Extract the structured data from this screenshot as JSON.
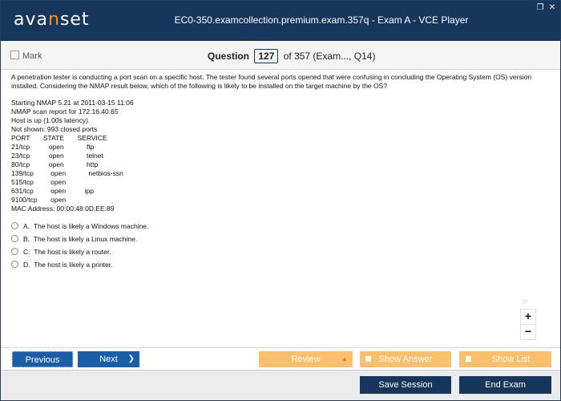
{
  "app": {
    "logo_prefix": "ava",
    "logo_accent": "n",
    "logo_suffix": "set",
    "window_title": "EC0-350.examcollection.premium.exam.357q - Exam A - VCE Player",
    "restore_glyph": "❐",
    "close_glyph": "✕"
  },
  "subbar": {
    "mark_label": "Mark",
    "question_label": "Question",
    "question_number": "127",
    "question_of": "of 357 (Exam..., Q14)"
  },
  "question": {
    "text": "A penetration tester is conducting a port scan on a specific host. The tester found several ports opened that were confusing in concluding the Operating System (OS) version installed. Considering the NMAP result below, which of the following is likely to be installed on the target machine by the OS?",
    "nmap": [
      "Starting NMAP 5.21 at 2011-03-15 11:06",
      "NMAP scan report for 172.16.40.65",
      "Host is up (1.00s latency).",
      "Not shown: 993 closed ports",
      "PORT       STATE       SERVICE",
      "21/tcp          open            ftp",
      "23/tcp          open            telnet",
      "80/tcp          open            http",
      "139/tcp         open            netbios-ssn",
      "515/tcp         open",
      "631/tcp         open          ipp",
      "9100/tcp       open",
      "MAC Address: 00:00:48:0D:EE:89"
    ],
    "options": [
      {
        "letter": "A.",
        "text": "The host is likely a Windows machine."
      },
      {
        "letter": "B.",
        "text": "The host is likely a Linux machine."
      },
      {
        "letter": "C.",
        "text": "The host is likely a router."
      },
      {
        "letter": "D.",
        "text": "The host is likely a printer."
      }
    ]
  },
  "zoom": {
    "search_glyph": "⌕",
    "plus": "+",
    "minus": "−"
  },
  "nav": {
    "previous": "Previous",
    "next": "Next",
    "next_arrow": "❯",
    "review": "Review",
    "review_arrow": "▲",
    "show_answer": "Show Answer",
    "show_list": "Show List"
  },
  "footer": {
    "save_session": "Save Session",
    "end_exam": "End Exam"
  },
  "colors": {
    "header": "#16365c",
    "accent_orange": "#f7941d",
    "nav_blue": "#1a5ea8",
    "nav_orange": "#fbbf6e"
  }
}
